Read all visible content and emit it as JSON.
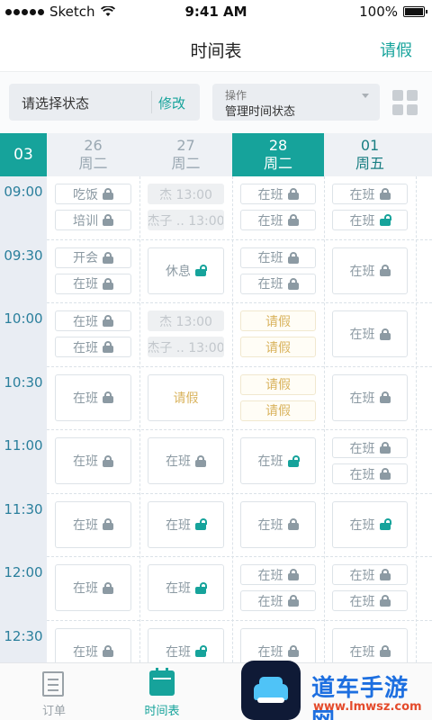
{
  "status_bar": {
    "carrier": "Sketch",
    "time": "9:41 AM",
    "battery": "100%"
  },
  "nav": {
    "title": "时间表",
    "action": "请假"
  },
  "toolbar": {
    "status_placeholder": "请选择状态",
    "modify": "修改",
    "op_label": "操作",
    "op_value": "管理时间状态"
  },
  "schedule": {
    "month": "03",
    "days": [
      {
        "date": "26",
        "weekday": "周二",
        "state": "dim"
      },
      {
        "date": "27",
        "weekday": "周二",
        "state": "dim"
      },
      {
        "date": "28",
        "weekday": "周二",
        "state": "active"
      },
      {
        "date": "01",
        "weekday": "周五",
        "state": "next"
      }
    ],
    "times": [
      "09:00",
      "09:30",
      "10:00",
      "10:30",
      "11:00",
      "11:30",
      "12:00",
      "12:30"
    ],
    "slots": [
      [
        {
          "cells": [
            {
              "t": "吃饭",
              "icon": "locked"
            },
            {
              "t": "培训",
              "icon": "locked"
            }
          ]
        },
        {
          "cells": [
            {
              "t": "杰 13:00",
              "style": "gray"
            },
            {
              "t": "杰子 .. 13:00",
              "style": "gray"
            }
          ]
        },
        {
          "cells": [
            {
              "t": "在班",
              "icon": "locked"
            },
            {
              "t": "在班",
              "icon": "locked"
            }
          ]
        },
        {
          "cells": [
            {
              "t": "在班",
              "icon": "locked"
            },
            {
              "t": "在班",
              "icon": "unlocked"
            }
          ]
        }
      ],
      [
        {
          "cells": [
            {
              "t": "开会",
              "icon": "locked"
            },
            {
              "t": "在班",
              "icon": "locked"
            }
          ]
        },
        {
          "cells": [
            {
              "t": "休息",
              "icon": "unlocked"
            }
          ]
        },
        {
          "cells": [
            {
              "t": "在班",
              "icon": "locked"
            },
            {
              "t": "在班",
              "icon": "locked"
            }
          ]
        },
        {
          "cells": [
            {
              "t": "在班",
              "icon": "locked"
            }
          ]
        }
      ],
      [
        {
          "cells": [
            {
              "t": "在班",
              "icon": "locked"
            },
            {
              "t": "在班",
              "icon": "locked"
            }
          ]
        },
        {
          "cells": [
            {
              "t": "杰 13:00",
              "style": "gray"
            },
            {
              "t": "杰子 .. 13:00",
              "style": "gray"
            }
          ]
        },
        {
          "cells": [
            {
              "t": "请假",
              "style": "leave"
            },
            {
              "t": "请假",
              "style": "leave"
            }
          ]
        },
        {
          "cells": [
            {
              "t": "在班",
              "icon": "locked"
            }
          ]
        }
      ],
      [
        {
          "cells": [
            {
              "t": "在班",
              "icon": "locked"
            }
          ]
        },
        {
          "cells": [
            {
              "t": "请假",
              "style": "leave-light"
            }
          ]
        },
        {
          "cells": [
            {
              "t": "请假",
              "style": "leave"
            },
            {
              "t": "请假",
              "style": "leave"
            }
          ]
        },
        {
          "cells": [
            {
              "t": "在班",
              "icon": "locked"
            }
          ]
        }
      ],
      [
        {
          "cells": [
            {
              "t": "在班",
              "icon": "locked"
            }
          ]
        },
        {
          "cells": [
            {
              "t": "在班",
              "icon": "locked"
            }
          ]
        },
        {
          "cells": [
            {
              "t": "在班",
              "icon": "unlocked"
            }
          ]
        },
        {
          "cells": [
            {
              "t": "在班",
              "icon": "locked"
            },
            {
              "t": "在班",
              "icon": "locked"
            }
          ]
        }
      ],
      [
        {
          "cells": [
            {
              "t": "在班",
              "icon": "locked"
            }
          ]
        },
        {
          "cells": [
            {
              "t": "在班",
              "icon": "unlocked"
            }
          ]
        },
        {
          "cells": [
            {
              "t": "在班",
              "icon": "locked"
            }
          ]
        },
        {
          "cells": [
            {
              "t": "在班",
              "icon": "unlocked"
            }
          ]
        }
      ],
      [
        {
          "cells": [
            {
              "t": "在班",
              "icon": "locked"
            }
          ]
        },
        {
          "cells": [
            {
              "t": "在班",
              "icon": "unlocked"
            }
          ]
        },
        {
          "cells": [
            {
              "t": "在班",
              "icon": "locked"
            },
            {
              "t": "在班",
              "icon": "locked"
            }
          ]
        },
        {
          "cells": [
            {
              "t": "在班",
              "icon": "locked"
            },
            {
              "t": "在班",
              "icon": "locked"
            }
          ]
        }
      ],
      [
        {
          "cells": [
            {
              "t": "在班",
              "icon": "locked"
            }
          ]
        },
        {
          "cells": [
            {
              "t": "在班",
              "icon": "unlocked"
            }
          ]
        },
        {
          "cells": [
            {
              "t": "在班",
              "icon": "locked"
            }
          ]
        },
        {
          "cells": [
            {
              "t": "在班",
              "icon": "locked"
            }
          ]
        }
      ]
    ]
  },
  "tabs": [
    {
      "label": "订单",
      "icon": "document-icon"
    },
    {
      "label": "时间表",
      "icon": "calendar-icon",
      "active": true
    }
  ],
  "watermark": {
    "title": "道车手游网",
    "url": "www.lmwsz.com"
  },
  "colors": {
    "accent": "#16a39b",
    "leave": "#d9b35d",
    "muted": "#8c9aa3"
  }
}
